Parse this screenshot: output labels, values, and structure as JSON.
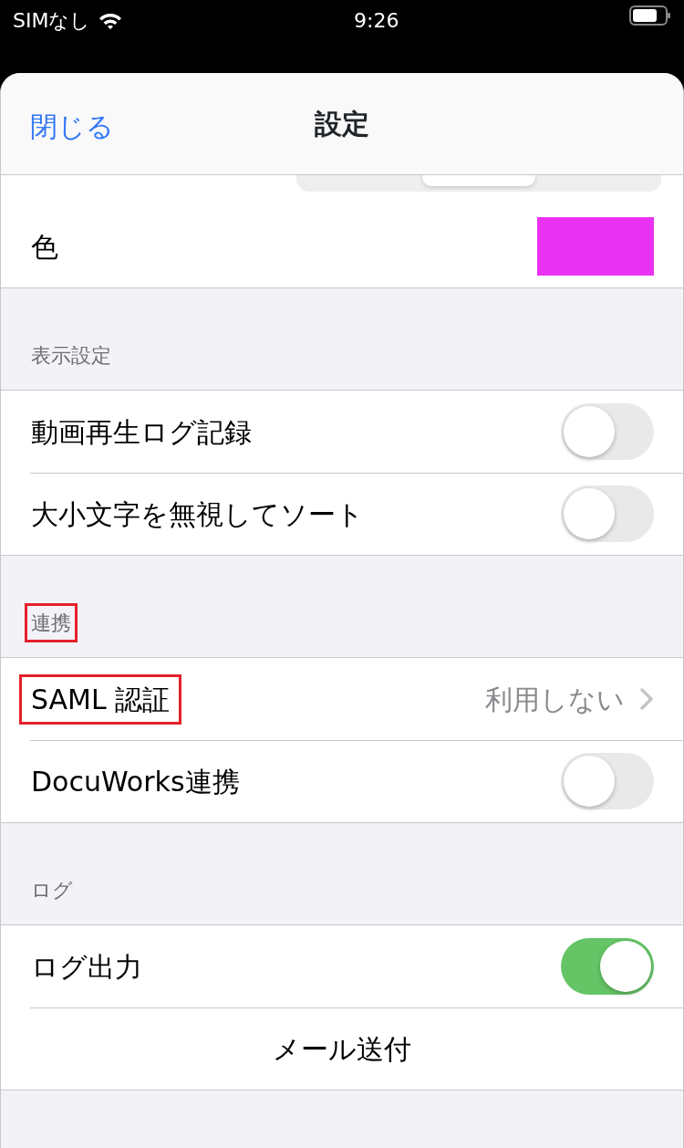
{
  "status_bar": {
    "carrier": "SIMなし",
    "time": "9:26"
  },
  "header": {
    "close": "閉じる",
    "title": "設定"
  },
  "sections": [
    {
      "rows": [
        {
          "kind": "segmented"
        },
        {
          "kind": "color",
          "label": "色",
          "color": "#ea33f2"
        }
      ]
    },
    {
      "title": "表示設定",
      "rows": [
        {
          "kind": "toggle",
          "label": "動画再生ログ記録",
          "on": false
        },
        {
          "kind": "toggle",
          "label": "大小文字を無視してソート",
          "on": false
        }
      ]
    },
    {
      "title": "連携",
      "highlighted": true,
      "rows": [
        {
          "kind": "link",
          "label": "SAML 認証",
          "value": "利用しない",
          "highlighted": true
        },
        {
          "kind": "toggle",
          "label": "DocuWorks連携",
          "on": false
        }
      ]
    },
    {
      "title": "ログ",
      "rows": [
        {
          "kind": "toggle",
          "label": "ログ出力",
          "on": true
        },
        {
          "kind": "action",
          "label": "メール送付"
        }
      ]
    }
  ]
}
